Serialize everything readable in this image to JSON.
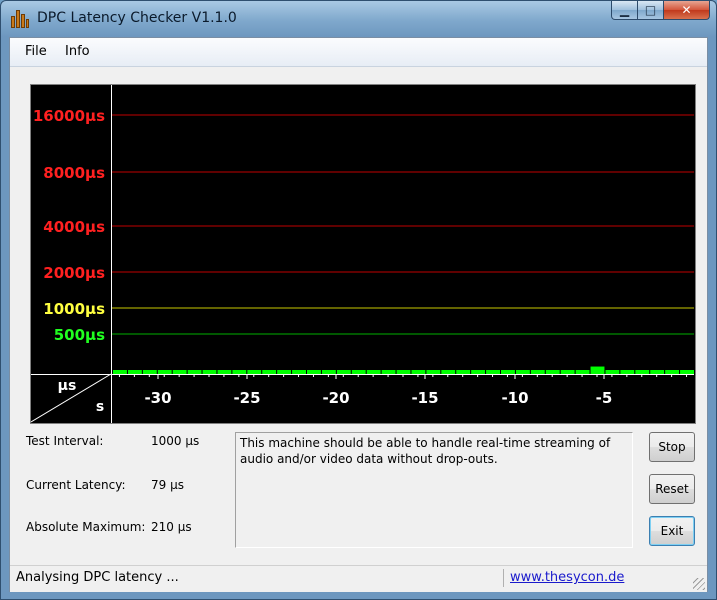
{
  "window": {
    "title": "DPC Latency Checker V1.1.0",
    "minimize": "▁",
    "maximize": "□",
    "close": "✕"
  },
  "menu": {
    "file": "File",
    "info": "Info"
  },
  "graph": {
    "y_labels": [
      {
        "text": "16000µs",
        "color": "#ff2020",
        "line_color": "#c00000"
      },
      {
        "text": "8000µs",
        "color": "#ff2020",
        "line_color": "#c00000"
      },
      {
        "text": "4000µs",
        "color": "#ff2020",
        "line_color": "#c00000"
      },
      {
        "text": "2000µs",
        "color": "#ff2020",
        "line_color": "#c00000"
      },
      {
        "text": "1000µs",
        "color": "#ffff40",
        "line_color": "#c8c800"
      },
      {
        "text": "500µs",
        "color": "#20ff20",
        "line_color": "#00b000"
      }
    ],
    "corner_units": {
      "y": "µs",
      "x": "s"
    },
    "x_ticks": [
      "-30",
      "-25",
      "-20",
      "-15",
      "-10",
      "-5"
    ],
    "bar_color": "#00ff00"
  },
  "chart_data": {
    "type": "bar",
    "xlabel": "s",
    "ylabel": "µs",
    "scale": "log",
    "threshold_lines": [
      16000,
      8000,
      4000,
      2000,
      1000,
      500
    ],
    "x": [
      -33,
      -32,
      -31,
      -30,
      -29,
      -28,
      -27,
      -26,
      -25,
      -24,
      -23,
      -22,
      -21,
      -20,
      -19,
      -18,
      -17,
      -16,
      -15,
      -14,
      -13,
      -12,
      -11,
      -10,
      -9,
      -8,
      -7,
      -6,
      -5,
      -4,
      -3,
      -2,
      -1
    ],
    "values": [
      85,
      85,
      100,
      95,
      85,
      90,
      100,
      95,
      90,
      90,
      90,
      95,
      90,
      90,
      90,
      90,
      85,
      90,
      95,
      95,
      90,
      90,
      90,
      90,
      95,
      95,
      90,
      90,
      90,
      90,
      95,
      85,
      210,
      100,
      95,
      85,
      90,
      85,
      79
    ]
  },
  "info": {
    "test_interval_label": "Test Interval:",
    "test_interval_value": "1000 µs",
    "current_latency_label": "Current Latency:",
    "current_latency_value": "79 µs",
    "absolute_max_label": "Absolute Maximum:",
    "absolute_max_value": "210 µs"
  },
  "message": "This machine should be able to handle real-time streaming of audio and/or video data without drop-outs.",
  "buttons": {
    "stop": "Stop",
    "reset": "Reset",
    "exit": "Exit"
  },
  "status": {
    "text": "Analysing DPC latency ...",
    "link": "www.thesycon.de"
  }
}
